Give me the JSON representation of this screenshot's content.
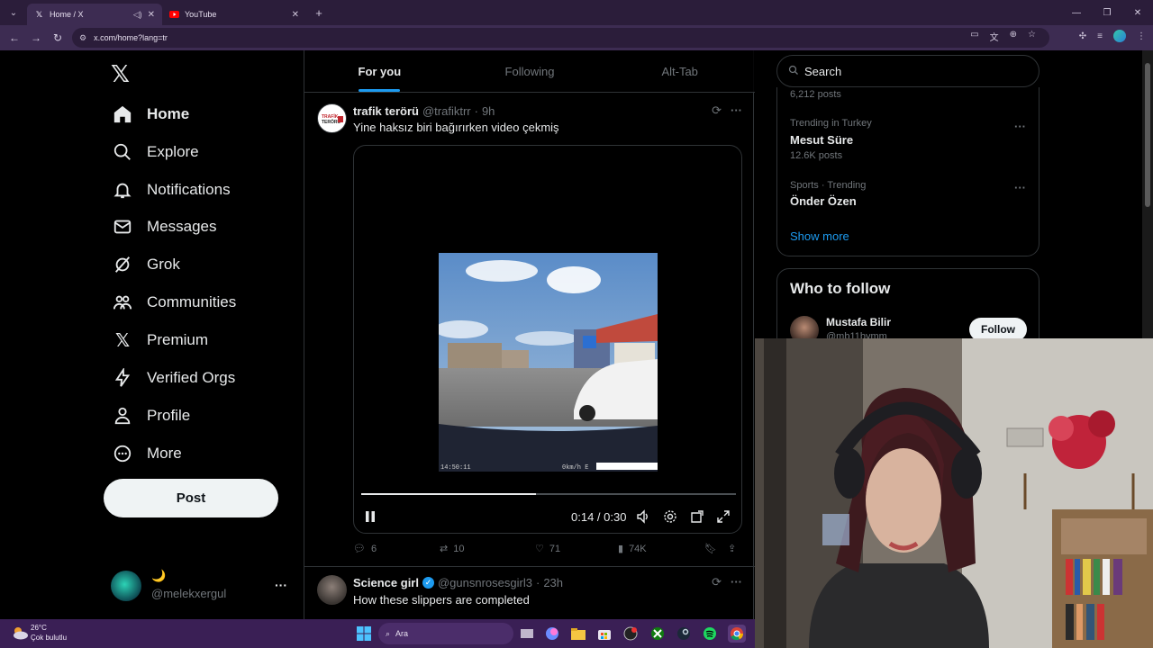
{
  "browser": {
    "tabs": [
      {
        "title": "Home / X",
        "active": true
      },
      {
        "title": "YouTube",
        "active": false
      }
    ],
    "url": "x.com/home?lang=tr"
  },
  "nav": {
    "items": [
      {
        "label": "Home",
        "icon": "home-icon"
      },
      {
        "label": "Explore",
        "icon": "search-icon"
      },
      {
        "label": "Notifications",
        "icon": "bell-icon"
      },
      {
        "label": "Messages",
        "icon": "envelope-icon"
      },
      {
        "label": "Grok",
        "icon": "grok-icon"
      },
      {
        "label": "Communities",
        "icon": "people-icon"
      },
      {
        "label": "Premium",
        "icon": "x-logo-icon"
      },
      {
        "label": "Verified Orgs",
        "icon": "lightning-icon"
      },
      {
        "label": "Profile",
        "icon": "person-icon"
      },
      {
        "label": "More",
        "icon": "more-circle-icon"
      }
    ],
    "post_label": "Post",
    "account": {
      "display_name": "🌙",
      "handle": "@melekxergul"
    }
  },
  "timeline": {
    "tabs": [
      {
        "label": "For you",
        "selected": true
      },
      {
        "label": "Following",
        "selected": false
      },
      {
        "label": "Alt-Tab",
        "selected": false
      }
    ],
    "tweets": [
      {
        "name": "trafik terörü",
        "handle": "@trafiktrr",
        "time": "9h",
        "text": "Yine haksız biri bağırırken video çekmiş",
        "video": {
          "time_display": "0:14 / 0:30",
          "progress": 0.466,
          "overlay_left": "14:50:11",
          "overlay_right": "0km/h E"
        },
        "stats": {
          "replies": "6",
          "reposts": "10",
          "likes": "71",
          "views": "74K"
        }
      },
      {
        "name": "Science girl",
        "handle": "@gunsnrosesgirl3",
        "time": "23h",
        "verified": true,
        "text": "How these slippers are completed"
      }
    ]
  },
  "sidebar": {
    "search_placeholder": "Search",
    "trends": [
      {
        "posts": "6,212 posts"
      },
      {
        "category": "Trending in Turkey",
        "title": "Mesut Süre",
        "posts": "12.6K posts"
      },
      {
        "category": "Sports · Trending",
        "title": "Önder Özen"
      }
    ],
    "show_more": "Show more",
    "who_to_follow": {
      "title": "Who to follow",
      "users": [
        {
          "name": "Mustafa Bilir",
          "handle": "@mb11bymm",
          "button": "Follow"
        }
      ]
    }
  },
  "taskbar": {
    "weather_temp": "26°C",
    "weather_desc": "Çok bulutlu",
    "search_label": "Ara"
  },
  "colors": {
    "accent": "#1d9bf0",
    "chrome": "#3d2c52",
    "taskbar": "#3a1f55"
  }
}
